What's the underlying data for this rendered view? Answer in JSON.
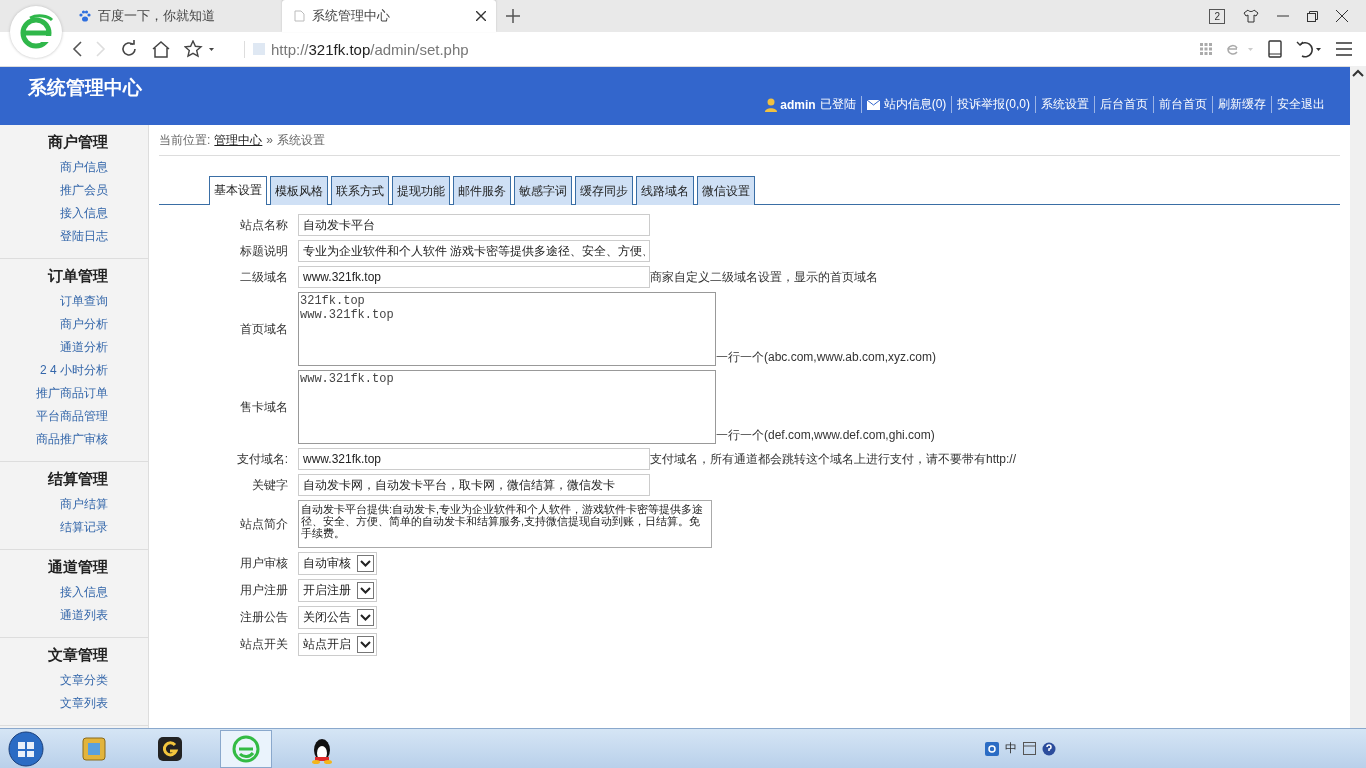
{
  "browser": {
    "tabs": [
      {
        "title": "百度一下，你就知道",
        "kind": "paw",
        "selected": false
      },
      {
        "title": "系统管理中心",
        "kind": "page",
        "selected": true
      }
    ],
    "window_count": "2",
    "url": {
      "scheme": "http://",
      "host": "321fk.top",
      "path": "/admin/set.php"
    }
  },
  "header": {
    "title": "系统管理中心",
    "user": "admin",
    "login_status": "已登陆",
    "links": [
      {
        "label": "站内信息(0)",
        "kind": "mail"
      },
      {
        "label": "投诉举报(0,0)",
        "kind": "plain"
      },
      {
        "label": "系统设置",
        "kind": "plain"
      },
      {
        "label": "后台首页",
        "kind": "plain"
      },
      {
        "label": "前台首页",
        "kind": "plain"
      },
      {
        "label": "刷新缓存",
        "kind": "plain"
      },
      {
        "label": "安全退出",
        "kind": "plain"
      }
    ]
  },
  "sidebar": {
    "groups": [
      {
        "heading": "商户管理",
        "items": [
          "商户信息",
          "推广会员",
          "接入信息",
          "登陆日志"
        ]
      },
      {
        "heading": "订单管理",
        "items": [
          "订单查询",
          "商户分析",
          "通道分析",
          "2 4 小时分析",
          "推广商品订单",
          "平台商品管理",
          "商品推广审核"
        ]
      },
      {
        "heading": "结算管理",
        "items": [
          "商户结算",
          "结算记录"
        ]
      },
      {
        "heading": "通道管理",
        "items": [
          "接入信息",
          "通道列表"
        ]
      },
      {
        "heading": "文章管理",
        "items": [
          "文章分类",
          "文章列表"
        ]
      }
    ]
  },
  "breadcrumb": {
    "label": "当前位置:",
    "link": "管理中心",
    "separator": "»",
    "current": "系统设置"
  },
  "tabs": [
    {
      "label": "基本设置",
      "selected": true
    },
    {
      "label": "模板风格",
      "selected": false
    },
    {
      "label": "联系方式",
      "selected": false
    },
    {
      "label": "提现功能",
      "selected": false
    },
    {
      "label": "邮件服务",
      "selected": false
    },
    {
      "label": "敏感字词",
      "selected": false
    },
    {
      "label": "缓存同步",
      "selected": false
    },
    {
      "label": "线路域名",
      "selected": false
    },
    {
      "label": "微信设置",
      "selected": false
    }
  ],
  "form": {
    "rows": [
      {
        "kind": "text",
        "label": "站点名称",
        "value": "自动发卡平台"
      },
      {
        "kind": "text",
        "label": "标题说明",
        "value": "专业为企业软件和个人软件 游戏卡密等提供多途径、安全、方便、"
      },
      {
        "kind": "text",
        "label": "二级域名",
        "value": "www.321fk.top",
        "hint": "商家自定义二级域名设置，显示的首页域名"
      },
      {
        "kind": "domains",
        "label": "首页域名",
        "value": "321fk.top\nwww.321fk.top",
        "hint": "一行一个(abc.com,www.ab.com,xyz.com)"
      },
      {
        "kind": "domains",
        "label": "售卡域名",
        "value": "www.321fk.top",
        "hint": "一行一个(def.com,www.def.com,ghi.com)"
      },
      {
        "kind": "text",
        "label": "支付域名:",
        "value": "www.321fk.top",
        "hint": "支付域名，所有通道都会跳转这个域名上进行支付，请不要带有http://"
      },
      {
        "kind": "text",
        "label": "关键字",
        "value": "自动发卡网，自动发卡平台，取卡网，微信结算，微信发卡"
      },
      {
        "kind": "textarea",
        "label": "站点简介",
        "value": "自动发卡平台提供:自动发卡,专业为企业软件和个人软件，游戏软件卡密等提供多途径、安全、方便、简单的自动发卡和结算服务,支持微信提现自动到账，日结算。免手续费。"
      },
      {
        "kind": "select",
        "label": "用户审核",
        "value": "自动审核"
      },
      {
        "kind": "select",
        "label": "用户注册",
        "value": "开启注册"
      },
      {
        "kind": "select",
        "label": "注册公告",
        "value": "关闭公告"
      },
      {
        "kind": "select",
        "label": "站点开关",
        "value": "站点开启"
      }
    ]
  },
  "taskbar": {
    "apps": [
      {
        "kind": "files",
        "selected": false
      },
      {
        "kind": "gamecenter",
        "selected": false
      },
      {
        "kind": "browser",
        "selected": true
      },
      {
        "kind": "penguin",
        "selected": false
      }
    ],
    "ime": "中"
  }
}
